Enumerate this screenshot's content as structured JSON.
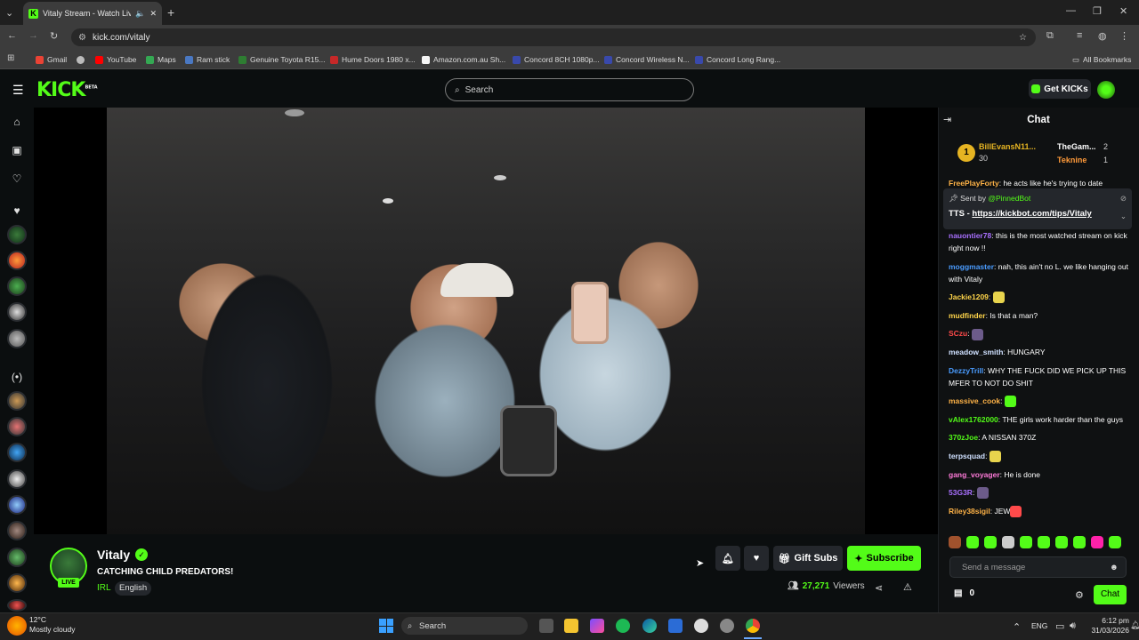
{
  "browser": {
    "tab_title": "Vitaly Stream - Watch Live on",
    "url": "kick.com/vitaly",
    "bookmarks": [
      "Gmail",
      "YouTube",
      "Maps",
      "Ram stick",
      "Genuine Toyota R15...",
      "Hume Doors 1980 x...",
      "Amazon.com.au Sh...",
      "Concord 8CH 1080p...",
      "Concord Wireless N...",
      "Concord Long Rang..."
    ],
    "all_bookmarks": "All Bookmarks"
  },
  "header": {
    "logo": "KICK",
    "logo_sup": "BETA",
    "search_placeholder": "Search",
    "get_kicks": "Get KICKs"
  },
  "stream": {
    "channel": "Vitaly",
    "live_badge": "LIVE",
    "title": "CATCHING CHILD PREDATORS!",
    "category": "IRL",
    "language": "English",
    "gift_subs": "Gift Subs",
    "subscribe": "Subscribe",
    "viewers_count": "27,271",
    "viewers_label": "Viewers"
  },
  "chat": {
    "title": "Chat",
    "leaderboard": [
      {
        "rank": "1",
        "name": "BillEvansN11...",
        "count": "30"
      },
      {
        "name": "TheGam...",
        "count": "2"
      },
      {
        "name": "Teknine",
        "count": "1"
      }
    ],
    "pinned": {
      "sent_by_label": "Sent by",
      "bot": "@PinnedBot",
      "text_prefix": "TTS - ",
      "link": "https://kickbot.com/tips/Vitaly"
    },
    "partial_top": {
      "user": "FreePlayForty",
      "text": "he acts like he's trying to date"
    },
    "messages": [
      {
        "user": "nauontier78",
        "color": "#a970ff",
        "text": "this is the most watched stream on kick right now !!"
      },
      {
        "user": "moggmaster",
        "color": "#4a9cff",
        "text": "nah, this ain't no L. we like hanging out with Vitaly"
      },
      {
        "user": "Jackie1209",
        "color": "#ffd54a",
        "text": ""
      },
      {
        "user": "mudfinder",
        "color": "#ffd54a",
        "text": "Is that a man?"
      },
      {
        "user": "SCzu",
        "color": "#ff4a4a",
        "text": ""
      },
      {
        "user": "meadow_smith",
        "color": "#cfe0ff",
        "text": "HUNGARY"
      },
      {
        "user": "DezzyTrill",
        "color": "#4a9cff",
        "text": "WHY THE FUCK DID WE PICK UP THIS MFER TO NOT DO SHIT"
      },
      {
        "user": "massive_cook",
        "color": "#ffb347",
        "text": ""
      },
      {
        "user": "vAlex1762000",
        "color": "#53fc18",
        "text": "THE girls work harder than the guys"
      },
      {
        "user": "370zJoe",
        "color": "#53fc18",
        "text": "A NISSAN 370Z"
      },
      {
        "user": "terpsquad",
        "color": "#cfe0ff",
        "text": ""
      },
      {
        "user": "gang_voyager",
        "color": "#ff7ad9",
        "text": "He is done"
      },
      {
        "user": "53G3R",
        "color": "#a970ff",
        "text": ""
      },
      {
        "user": "Riley38sigil",
        "color": "#ffb347",
        "text": "JEW"
      }
    ],
    "send_placeholder": "Send a message",
    "kicks_count": "0",
    "chat_button": "Chat"
  },
  "taskbar": {
    "weather_temp": "12°C",
    "weather_desc": "Mostly cloudy",
    "search": "Search",
    "lang": "ENG",
    "time": "6:12 pm",
    "date": "31/03/2026"
  }
}
